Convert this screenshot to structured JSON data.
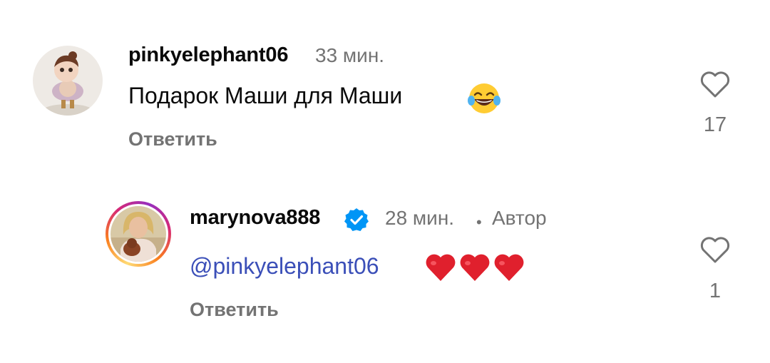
{
  "comments": [
    {
      "username": "pinkyelephant06",
      "time": "33 мин.",
      "text": "Подарок Маши для Маши",
      "emoji": "rolling-on-floor-laughing",
      "reply_label": "Ответить",
      "like_count": "17"
    },
    {
      "username": "marynova888",
      "verified": true,
      "time": "28 мин.",
      "separator": "•",
      "author_label": "Автор",
      "mention": "@pinkyelephant06",
      "hearts": 3,
      "reply_label": "Ответить",
      "like_count": "1"
    }
  ],
  "colors": {
    "mention": "#3b4fb8",
    "verified": "#0095f6",
    "heart": "#e0202d",
    "secondary_text": "#737373"
  }
}
